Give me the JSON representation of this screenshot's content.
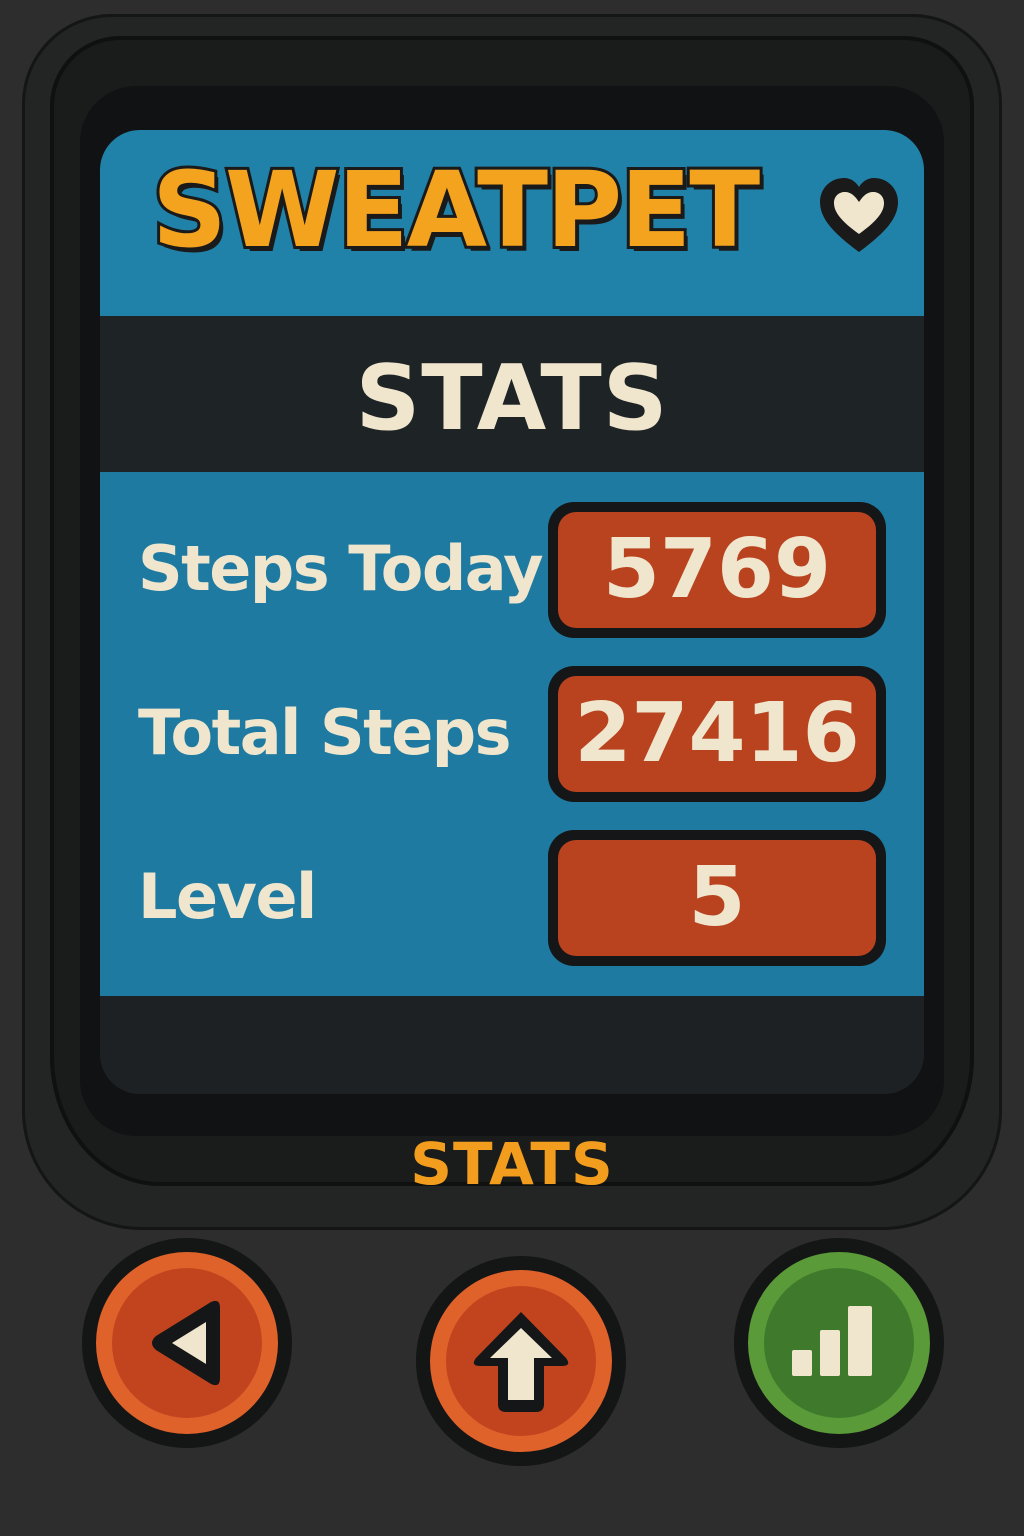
{
  "app": {
    "logo_text": "SWEATPET"
  },
  "screen": {
    "title": "STATS",
    "stats": [
      {
        "label": "Steps Today",
        "value": "5769"
      },
      {
        "label": "Total Steps",
        "value": "27416"
      },
      {
        "label": "Level",
        "value": "5"
      }
    ]
  },
  "device": {
    "mode_label": "STATS",
    "buttons": [
      {
        "icon": "left-arrow-icon",
        "color": "#c2441f"
      },
      {
        "icon": "up-arrow-icon",
        "color": "#c2441f"
      },
      {
        "icon": "stats-bars-icon",
        "color": "#3f7a2c"
      }
    ]
  },
  "colors": {
    "logo": "#f4a31f",
    "header_bg": "#2182a9",
    "panel_bg": "#1e7aa1",
    "value_box": "#b9421f",
    "text_cream": "#efe6cd",
    "mode_label": "#f29d1d"
  }
}
